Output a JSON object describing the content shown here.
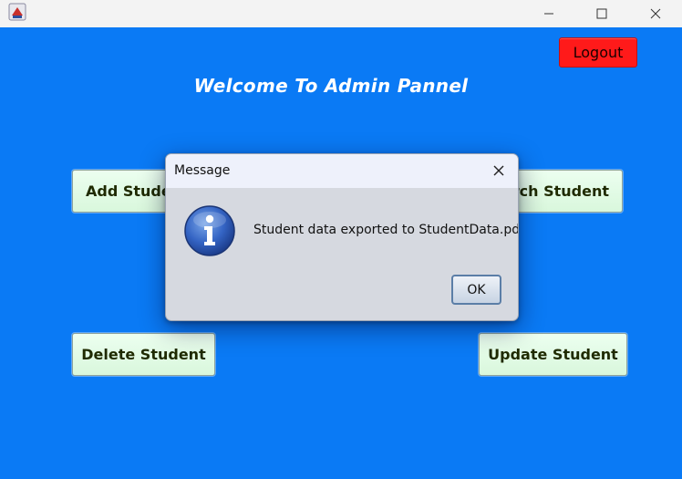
{
  "window": {
    "icon": "java-app-icon",
    "controls": {
      "minimize": "minimize-icon",
      "maximize": "maximize-icon",
      "close": "close-icon"
    }
  },
  "main": {
    "logout_label": "Logout",
    "title": "Welcome To Admin Pannel",
    "buttons": {
      "add": "Add Student",
      "search": "Search Student",
      "delete": "Delete Student",
      "update": "Update Student"
    }
  },
  "dialog": {
    "title": "Message",
    "icon": "info-icon",
    "message": "Student data exported to StudentData.pdf!",
    "ok_label": "OK"
  },
  "colors": {
    "background": "#0a7af5",
    "logout": "#ff1a1a",
    "action_button": "#ddf8df",
    "dialog_body": "#d6d9e0",
    "dialog_titlebar": "#eef1fb"
  }
}
